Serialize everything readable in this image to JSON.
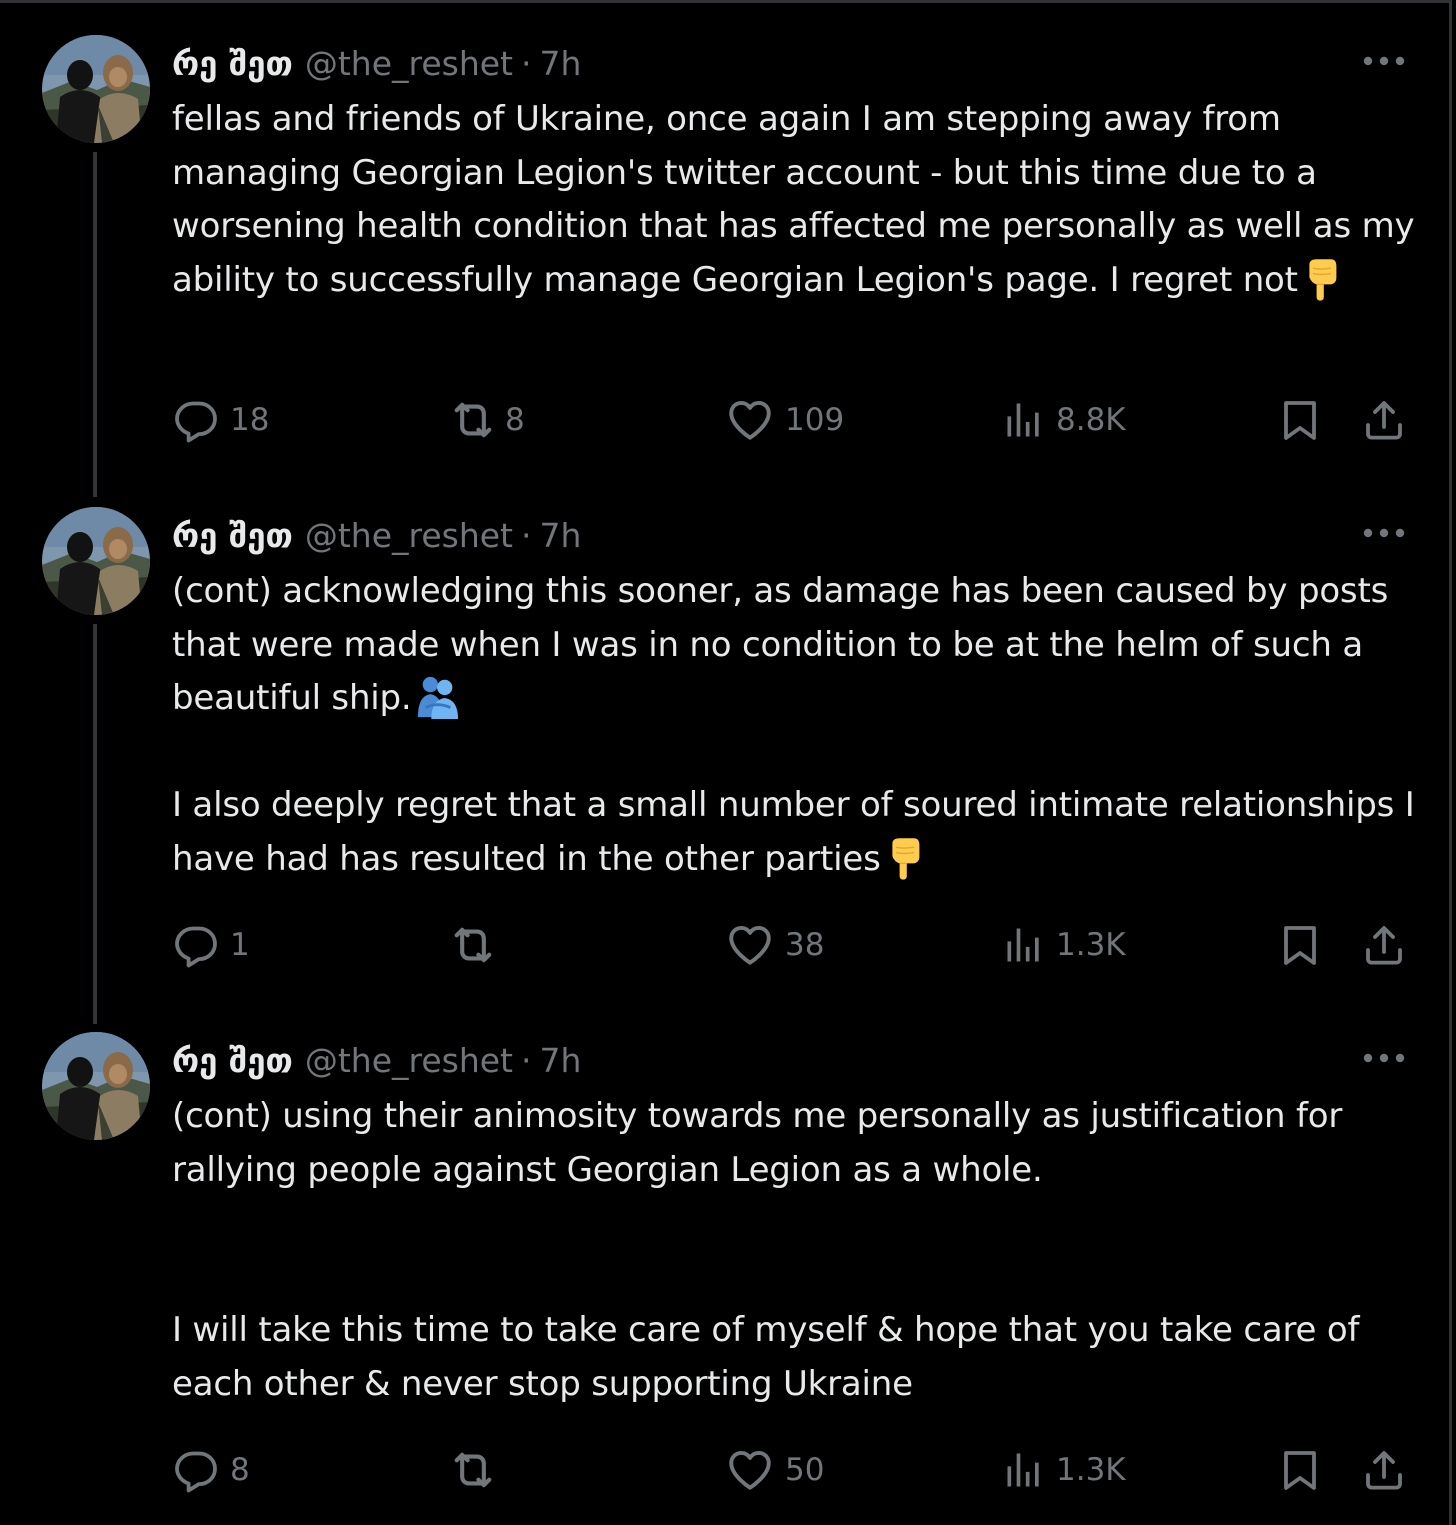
{
  "colors": {
    "background": "#000000",
    "text_primary": "#e7e9ea",
    "text_secondary": "#71767b",
    "thread_line": "#333639"
  },
  "tweets": [
    {
      "display_name": "რე შეთ",
      "handle": "@the_reshet",
      "separator": "·",
      "time": "7h",
      "text": "fellas and friends of Ukraine, once again I am stepping away from managing Georgian Legion's twitter account - but this time due to a worsening health condition that has affected me personally as well as my ability to successfully manage Georgian Legion's page. I regret not",
      "emoji": "pointing-down-hand",
      "stats": {
        "replies": "18",
        "reposts": "8",
        "likes": "109",
        "views": "8.8K"
      }
    },
    {
      "display_name": "რე შეთ",
      "handle": "@the_reshet",
      "separator": "·",
      "time": "7h",
      "text": "(cont) acknowledging this sooner, as damage has been caused by posts that were made when I was in no condition to be at the helm of such a beautiful ship.",
      "emoji_inline": "people-hugging",
      "text2": "I also deeply regret that a small number of soured intimate relationships I have had has resulted in the other parties",
      "emoji": "pointing-down-hand",
      "stats": {
        "replies": "1",
        "reposts": "",
        "likes": "38",
        "views": "1.3K"
      }
    },
    {
      "display_name": "რე შეთ",
      "handle": "@the_reshet",
      "separator": "·",
      "time": "7h",
      "text": "(cont) using their animosity towards me personally as justification for rallying people against Georgian Legion as a whole.",
      "text2": "I will take this time to take care of myself & hope that you take care of each other & never stop supporting Ukraine",
      "stats": {
        "replies": "8",
        "reposts": "",
        "likes": "50",
        "views": "1.3K"
      }
    }
  ]
}
